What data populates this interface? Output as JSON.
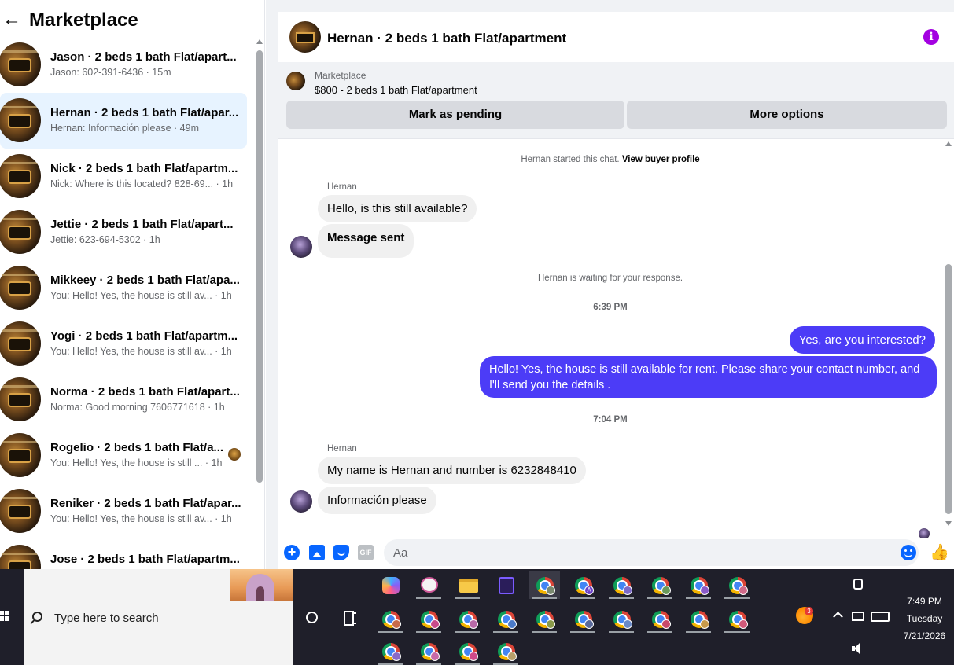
{
  "sidebar": {
    "title": "Marketplace",
    "conversations": [
      {
        "name": "Jason · 2 beds 1 bath Flat/apart...",
        "snippet": "Jason: 602-391-6436 · 15m"
      },
      {
        "name": "Hernan · 2 beds 1 bath Flat/apar...",
        "snippet": "Hernan: Información please · 49m"
      },
      {
        "name": "Nick · 2 beds 1 bath Flat/apartm...",
        "snippet": "Nick: Where is this located? 828-69... · 1h"
      },
      {
        "name": "Jettie · 2 beds 1 bath Flat/apart...",
        "snippet": "Jettie: 623-694-5302 · 1h"
      },
      {
        "name": "Mikkeey · 2 beds 1 bath Flat/apa...",
        "snippet": "You: Hello! Yes, the house is still av... · 1h"
      },
      {
        "name": "Yogi · 2 beds 1 bath Flat/apartm...",
        "snippet": "You: Hello! Yes, the house is still av... · 1h"
      },
      {
        "name": "Norma · 2 beds 1 bath Flat/apart...",
        "snippet": "Norma: Good morning 7606771618 · 1h"
      },
      {
        "name": "Rogelio · 2 beds 1 bath Flat/a...",
        "snippet": "You: Hello! Yes, the house is still ... · 1h"
      },
      {
        "name": "Reniker · 2 beds 1 bath Flat/apar...",
        "snippet": "You: Hello! Yes, the house is still av... · 1h"
      },
      {
        "name": "Jose · 2 beds 1 bath Flat/apartm...",
        "snippet": ""
      }
    ]
  },
  "chat": {
    "title": "Hernan · 2 beds 1 bath Flat/apartment",
    "listing": {
      "label": "Marketplace",
      "price_title": "$800 - 2 beds 1 bath Flat/apartment",
      "pending_label": "Mark as pending",
      "more_label": "More options"
    },
    "started_text": "Hernan started this chat.",
    "buyer_profile_link": "View buyer profile",
    "sender_name": "Hernan",
    "msg_in_1": "Hello, is this still available?",
    "msg_in_2": "Message sent",
    "waiting_text": "Hernan is waiting for your response.",
    "time_1": "6:39 PM",
    "msg_out_1": "Yes, are you interested?",
    "msg_out_2_line1": "Hello! Yes, the house is still available for rent. Please share your contact number, and",
    "msg_out_2_line2": "I'll send you the details .",
    "time_2": "7:04 PM",
    "msg_in_3": "My name is Hernan and number is 6232848410",
    "msg_in_4": "Información please",
    "composer_placeholder": "Aa",
    "gif_label": "GIF"
  },
  "taskbar": {
    "search_placeholder": "Type here to search",
    "clock_time": "7:49 PM",
    "clock_day": "Tuesday",
    "clock_date": "7/21/2026",
    "weather_badge": "3",
    "profile_letter": "A"
  },
  "colors": {
    "accent_blue": "#0866ff",
    "outgoing_bubble": "#4c3cf7",
    "info_purple": "#a301e1",
    "active_conv": "#e7f3ff"
  }
}
